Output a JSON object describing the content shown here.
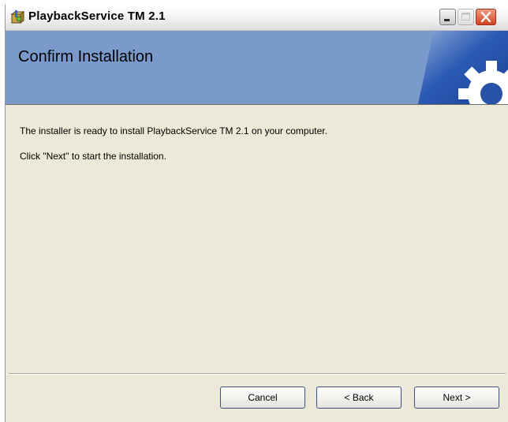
{
  "window": {
    "title": "PlaybackService TM 2.1",
    "icons": {
      "app": "installer-package-icon",
      "minimize": "minimize-icon",
      "maximize": "maximize-icon",
      "close": "close-icon"
    }
  },
  "header": {
    "title": "Confirm Installation",
    "art": "gear-icon",
    "background_color": "#7a9acb"
  },
  "content": {
    "line1": "The installer is ready to install PlaybackService TM 2.1 on your computer.",
    "line2": "Click \"Next\" to start the installation."
  },
  "footer": {
    "cancel_label": "Cancel",
    "back_label": "< Back",
    "next_label": "Next >"
  },
  "colors": {
    "dialog_background": "#ece9d8",
    "close_button": "#d2431f"
  }
}
